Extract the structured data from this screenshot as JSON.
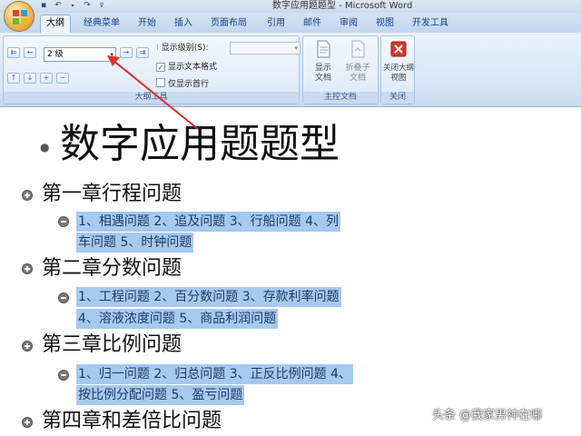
{
  "window": {
    "title": "数字应用题题型 - Microsoft Word"
  },
  "quick_access": [
    "save-icon",
    "undo-icon",
    "redo-icon",
    "customize-icon"
  ],
  "tabs": [
    {
      "label": "大纲",
      "active": true
    },
    {
      "label": "经典菜单"
    },
    {
      "label": "开始"
    },
    {
      "label": "插入"
    },
    {
      "label": "页面布局"
    },
    {
      "label": "引用"
    },
    {
      "label": "邮件"
    },
    {
      "label": "审阅"
    },
    {
      "label": "视图"
    },
    {
      "label": "开发工具"
    }
  ],
  "ribbon": {
    "outline_tools": {
      "level_value": "2 级",
      "show_level_label": "显示级别(S):",
      "show_text_format_label": "显示文本格式",
      "show_text_format_checked": true,
      "first_line_only_label": "仅显示首行",
      "first_line_only_checked": false,
      "group_label": "大纲工具"
    },
    "master_doc": {
      "show_doc_label": "显示文档",
      "collapse_sub_label": "折叠子文档",
      "group_label": "主控文档"
    },
    "close": {
      "close_outline_label": "关闭大纲视图",
      "group_label": "关闭"
    }
  },
  "document": {
    "title": "数字应用题题型",
    "chapters": [
      {
        "heading": "第一章行程问题",
        "lines": [
          "1、相遇问题 2、追及问题 3、行船问题 4、列",
          "车问题 5、时钟问题"
        ]
      },
      {
        "heading": "第二章分数问题",
        "lines": [
          "1、工程问题 2、百分数问题 3、存款利率问题",
          "4、溶液浓度问题 5、商品利润问题"
        ]
      },
      {
        "heading": "第三章比例问题",
        "lines": [
          "1、归一问题  2、归总问题  3、正反比例问题  4、",
          "按比例分配问题 5、盈亏问题"
        ]
      },
      {
        "heading": "第四章和差倍比问题",
        "lines": []
      }
    ]
  },
  "watermark": "头条 @我家男神在哪",
  "colors": {
    "selection": "#a6c9ee",
    "annotation_arrow": "#e0302a",
    "ribbon": "#dde9f7"
  }
}
